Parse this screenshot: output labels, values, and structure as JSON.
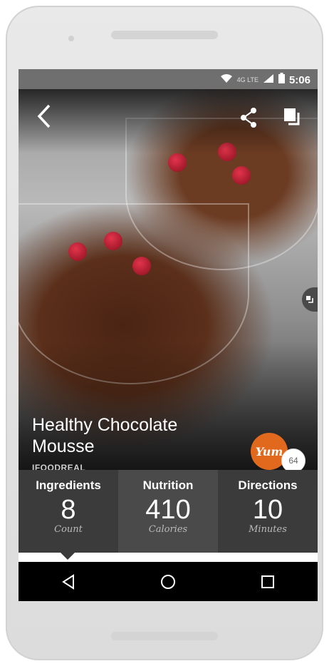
{
  "status_bar": {
    "time": "5:06",
    "network": "4G LTE"
  },
  "recipe": {
    "title_line1": "Healthy Chocolate",
    "title_line2": "Mousse",
    "source": "IFOODREAL",
    "badge_text": "Yum",
    "yum_count": "64"
  },
  "stats": [
    {
      "label": "Ingredients",
      "value": "8",
      "unit": "Count"
    },
    {
      "label": "Nutrition",
      "value": "410",
      "unit": "Calories"
    },
    {
      "label": "Directions",
      "value": "10",
      "unit": "Minutes"
    }
  ],
  "icons": {
    "back": "chevron-left-icon",
    "share": "share-icon",
    "collections": "copy-stack-icon",
    "side": "collapse-icon",
    "nav_back": "triangle-back-icon",
    "nav_home": "circle-home-icon",
    "nav_recents": "square-recents-icon"
  },
  "colors": {
    "accent": "#e0691d",
    "stat_bg": "#4a4a4a",
    "stat_active_bg": "#3b3b3b"
  }
}
